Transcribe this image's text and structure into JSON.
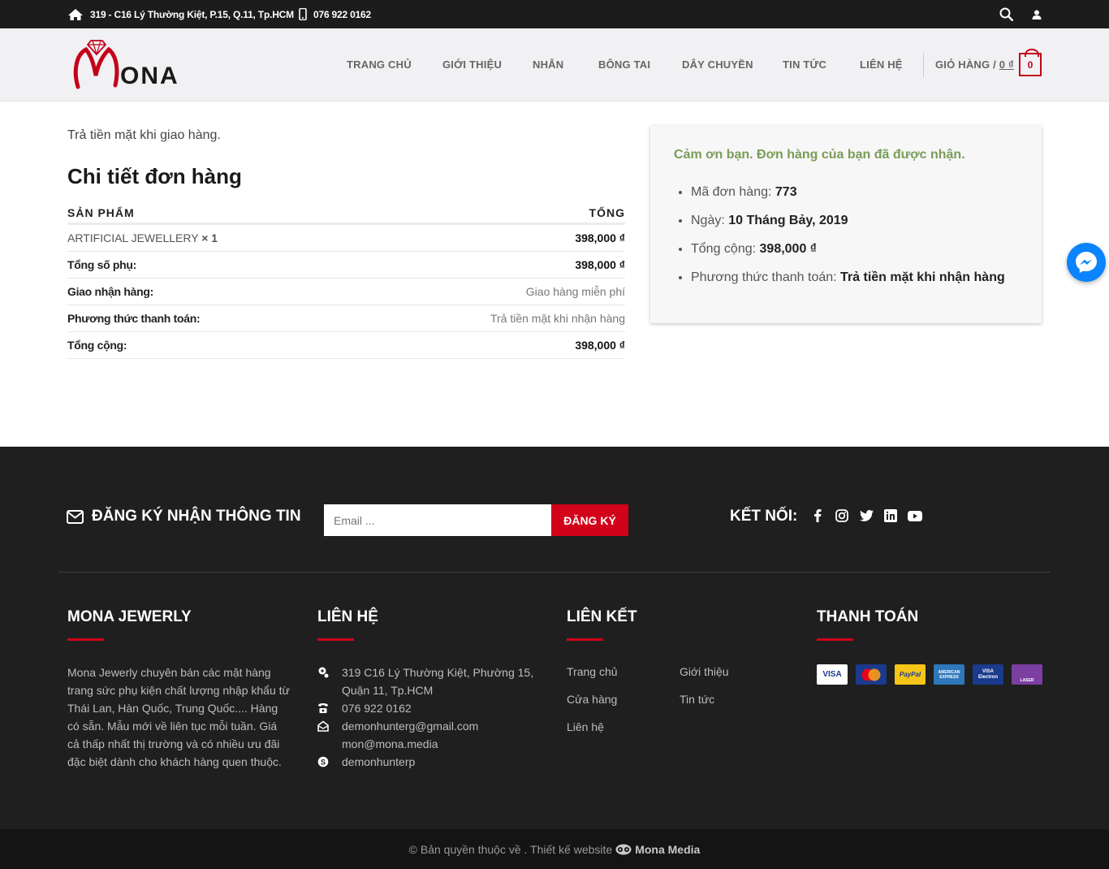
{
  "topbar": {
    "address": "319 - C16 Lý Thường Kiệt, P.15, Q.11, Tp.HCM",
    "phone": "076 922 0162"
  },
  "header": {
    "logo_text": "ONA",
    "nav": [
      "TRANG CHỦ",
      "GIỚI THIỆU",
      "NHẪN",
      "BÔNG TAI",
      "DÂY CHUYỀN",
      "TIN TỨC",
      "LIÊN HỆ"
    ],
    "cart_label": "GIỎ HÀNG /",
    "cart_amount": "0 ₫",
    "cart_count": "0"
  },
  "order": {
    "cod_note": "Trả tiền mặt khi giao hàng.",
    "title": "Chi tiết đơn hàng",
    "col_product": "SẢN PHẨM",
    "col_total": "TỔNG",
    "product_name": "ARTIFICIAL JEWELLERY",
    "product_qty": "× 1",
    "product_total": "398,000 ₫",
    "rows": [
      {
        "label": "Tổng số phụ:",
        "value": "398,000 ₫"
      },
      {
        "label": "Giao nhận hàng:",
        "value": "Giao hàng miễn phí"
      },
      {
        "label": "Phương thức thanh toán:",
        "value": "Trả tiền mặt khi nhận hàng"
      },
      {
        "label": "Tổng cộng:",
        "value": "398,000 ₫"
      }
    ]
  },
  "thanks": {
    "message": "Cảm ơn bạn. Đơn hàng của bạn đã được nhận.",
    "items": [
      {
        "label": "Mã đơn hàng:",
        "value": "773"
      },
      {
        "label": "Ngày:",
        "value": "10 Tháng Bảy, 2019"
      },
      {
        "label": "Tổng cộng:",
        "value": "398,000 ₫"
      },
      {
        "label": "Phương thức thanh toán:",
        "value": "Trả tiền mặt khi nhận hàng"
      }
    ]
  },
  "footer": {
    "newsletter_title": "ĐĂNG KÝ NHẬN THÔNG TIN",
    "email_placeholder": "Email ...",
    "subscribe_label": "ĐĂNG KÝ",
    "connect_label": "KẾT NỐI:",
    "socials": [
      "facebook-icon",
      "instagram-icon",
      "twitter-icon",
      "linkedin-icon",
      "youtube-icon"
    ],
    "col_about_title": "MONA JEWERLY",
    "about_text": "Mona Jewerly chuyên bán các mặt hàng trang sức phụ kiện chất lượng nhập khẩu từ Thái Lan, Hàn Quốc, Trung Quốc.... Hàng có sẵn. Mẫu mới về liên tục mỗi tuần. Giá cả thấp nhất thị trường và có nhiều ưu đãi đặc biệt dành cho khách hàng quen thuộc.",
    "col_contact_title": "LIÊN HỆ",
    "contact_address": "319 C16 Lý Thường Kiệt, Phường 15, Quận 11, Tp.HCM",
    "contact_phone": "076 922 0162",
    "contact_email_1": "demonhunterg@gmail.com",
    "contact_email_2": "mon@mona.media",
    "contact_skype": "demonhunterp",
    "col_links_title": "LIÊN KẾT",
    "links": [
      "Trang chủ",
      "Giới thiệu",
      "Cửa hàng",
      "Tin tức",
      "Liên hệ"
    ],
    "col_payment_title": "THANH TOÁN",
    "payments": [
      "VISA",
      "MasterCard",
      "PayPal",
      "AMERICAN EXPRESS",
      "VISA Electron",
      "LASER"
    ],
    "copyright_prefix": "© Bản quyền thuộc về . Thiết kế website",
    "copyright_brand": "Mona Media"
  },
  "colors": {
    "accent": "#d1021a",
    "success": "#7a9c59",
    "dark": "#1f1f1f",
    "messenger": "#0a84ff"
  }
}
